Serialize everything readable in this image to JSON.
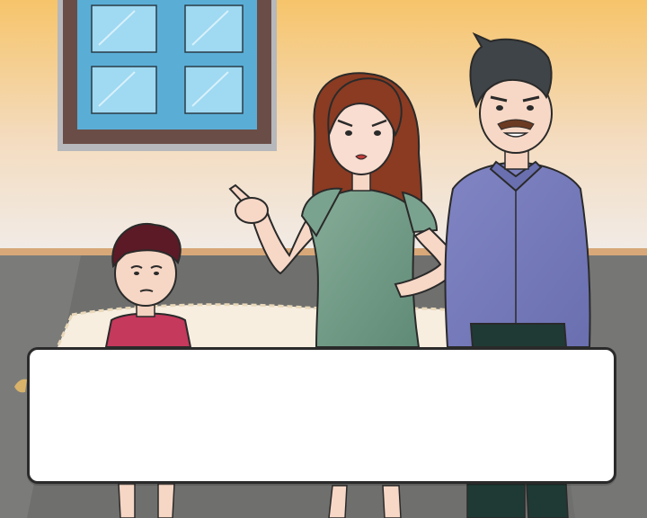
{
  "scene": {
    "characters": [
      "boy",
      "mother",
      "father"
    ],
    "colors": {
      "wall_top": "#f6c46a",
      "wall_bottom": "#f3e9e2",
      "floor": "#6f706e",
      "window_frame": "#6b4d47",
      "window_glass": "#8fd0ec",
      "mother_dress": "#7aa38f",
      "father_shirt": "#7b7fbf",
      "boy_shirt": "#c4395c"
    }
  },
  "dialog": {
    "text": ""
  }
}
